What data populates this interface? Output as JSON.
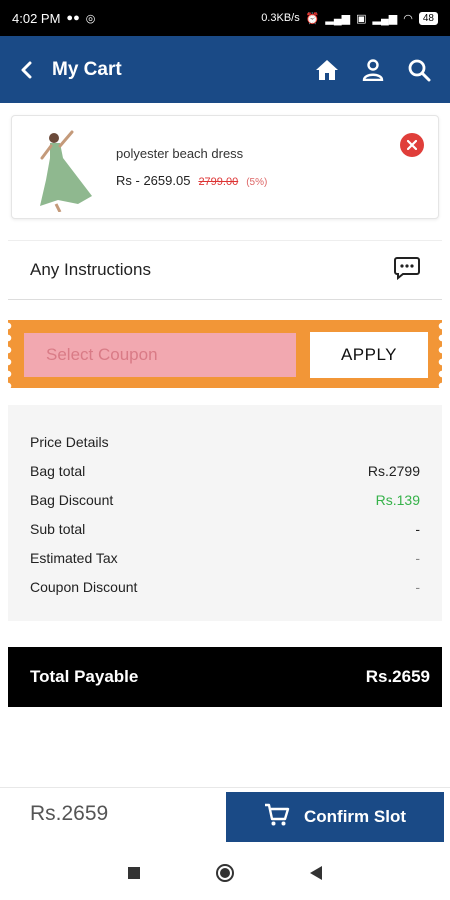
{
  "status": {
    "time": "4:02 PM",
    "speed": "0.3KB/s",
    "battery": "48"
  },
  "header": {
    "title": "My Cart"
  },
  "item": {
    "name": "polyester beach dress",
    "price": "Rs - 2659.05",
    "old_price": "2799.00",
    "discount": "(5%)"
  },
  "instructions": {
    "label": "Any Instructions"
  },
  "coupon": {
    "placeholder": "Select Coupon",
    "apply_label": "APPLY"
  },
  "price_details": {
    "title": "Price Details",
    "rows": [
      {
        "label": "Bag total",
        "value": "Rs.2799"
      },
      {
        "label": "Bag Discount",
        "value": "Rs.139"
      },
      {
        "label": "Sub total",
        "value": "-"
      },
      {
        "label": "Estimated Tax",
        "value": "-"
      },
      {
        "label": "Coupon Discount",
        "value": "-"
      }
    ]
  },
  "total": {
    "label": "Total Payable",
    "value": "Rs.2659"
  },
  "footer": {
    "amount": "Rs.2659",
    "confirm_label": "Confirm Slot"
  },
  "colors": {
    "primary": "#1a4a86",
    "coupon_band": "#f29637",
    "coupon_input": "#f2a8b0",
    "discount_green": "#36b24a",
    "remove_red": "#e03e3a"
  }
}
